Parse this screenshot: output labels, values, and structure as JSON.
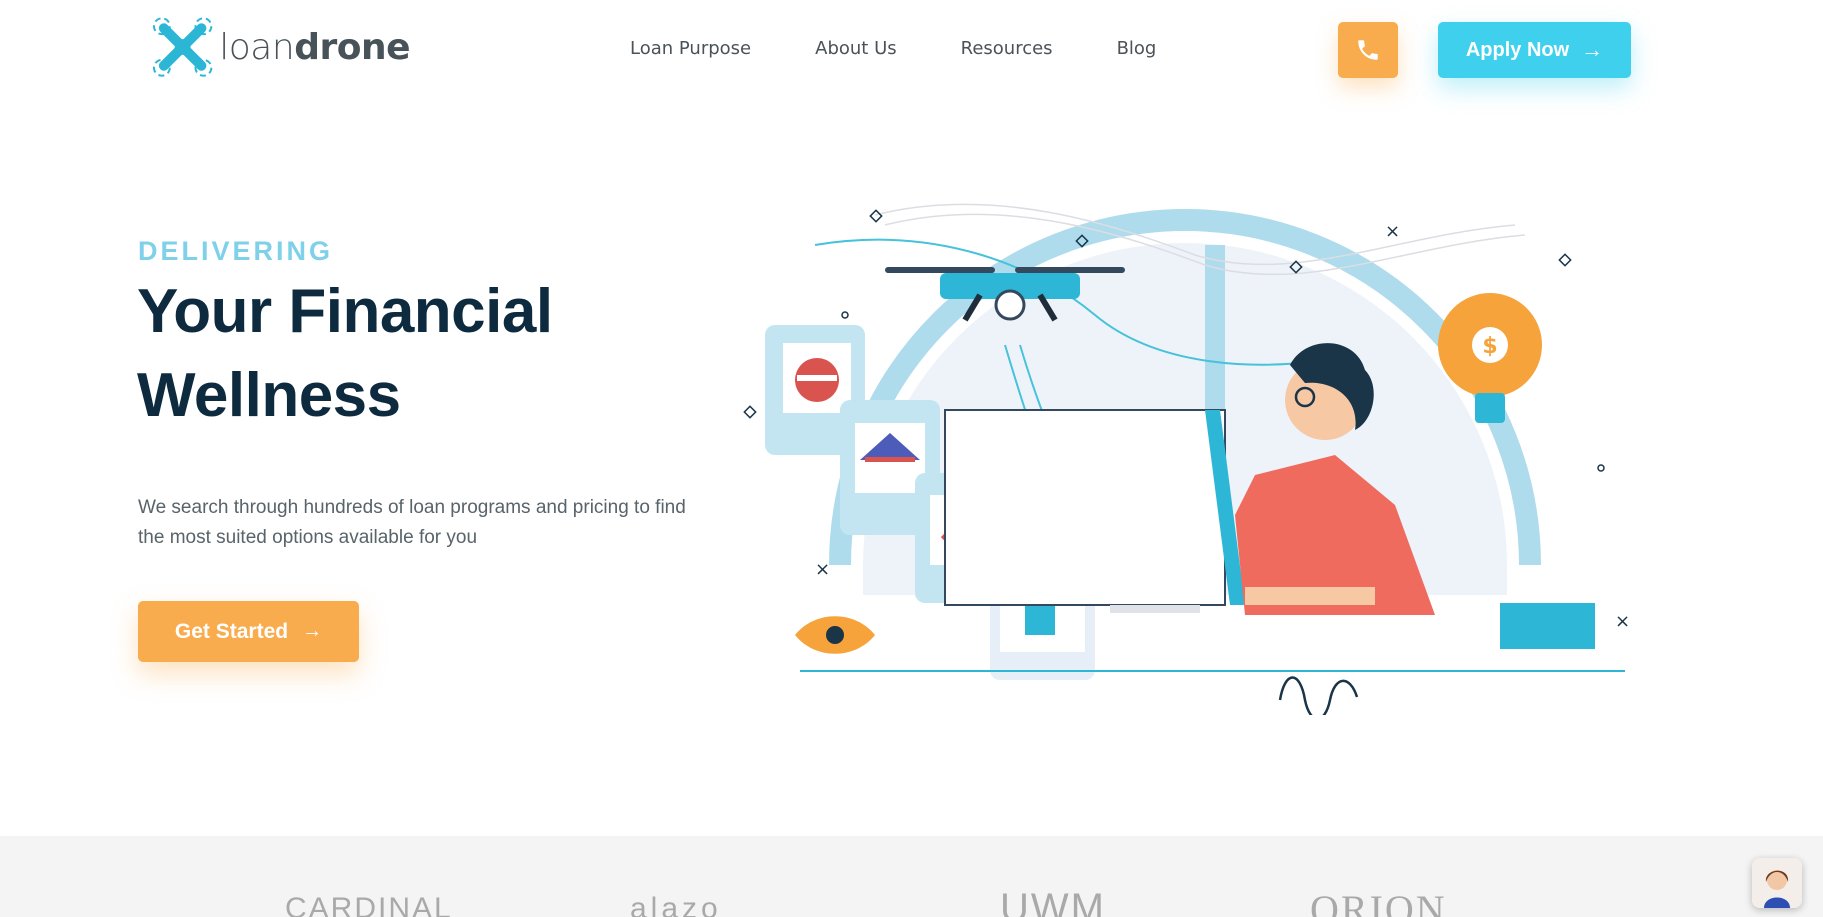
{
  "header": {
    "logo": {
      "text_light": "loan",
      "text_bold": "drone",
      "icon": "drone-logo-icon"
    },
    "nav": [
      {
        "label": "Loan Purpose"
      },
      {
        "label": "About Us"
      },
      {
        "label": "Resources"
      },
      {
        "label": "Blog"
      }
    ],
    "phone_icon": "phone-icon",
    "apply_label": "Apply Now",
    "apply_arrow": "→"
  },
  "hero": {
    "eyebrow": "DELIVERING",
    "title": "Your Financial Wellness",
    "description": "We search through hundreds of loan programs and pricing to find the most suited options available for you",
    "cta_label": "Get Started",
    "cta_arrow": "→"
  },
  "partners": [
    {
      "name": "CARDINAL"
    },
    {
      "name": "alazo"
    },
    {
      "name": "UWM"
    },
    {
      "name": "ORION"
    }
  ],
  "colors": {
    "accent_orange": "#f9ac4d",
    "accent_cyan": "#3fd0ee",
    "eyebrow": "#7fd1ea",
    "heading": "#0d2a3e"
  }
}
